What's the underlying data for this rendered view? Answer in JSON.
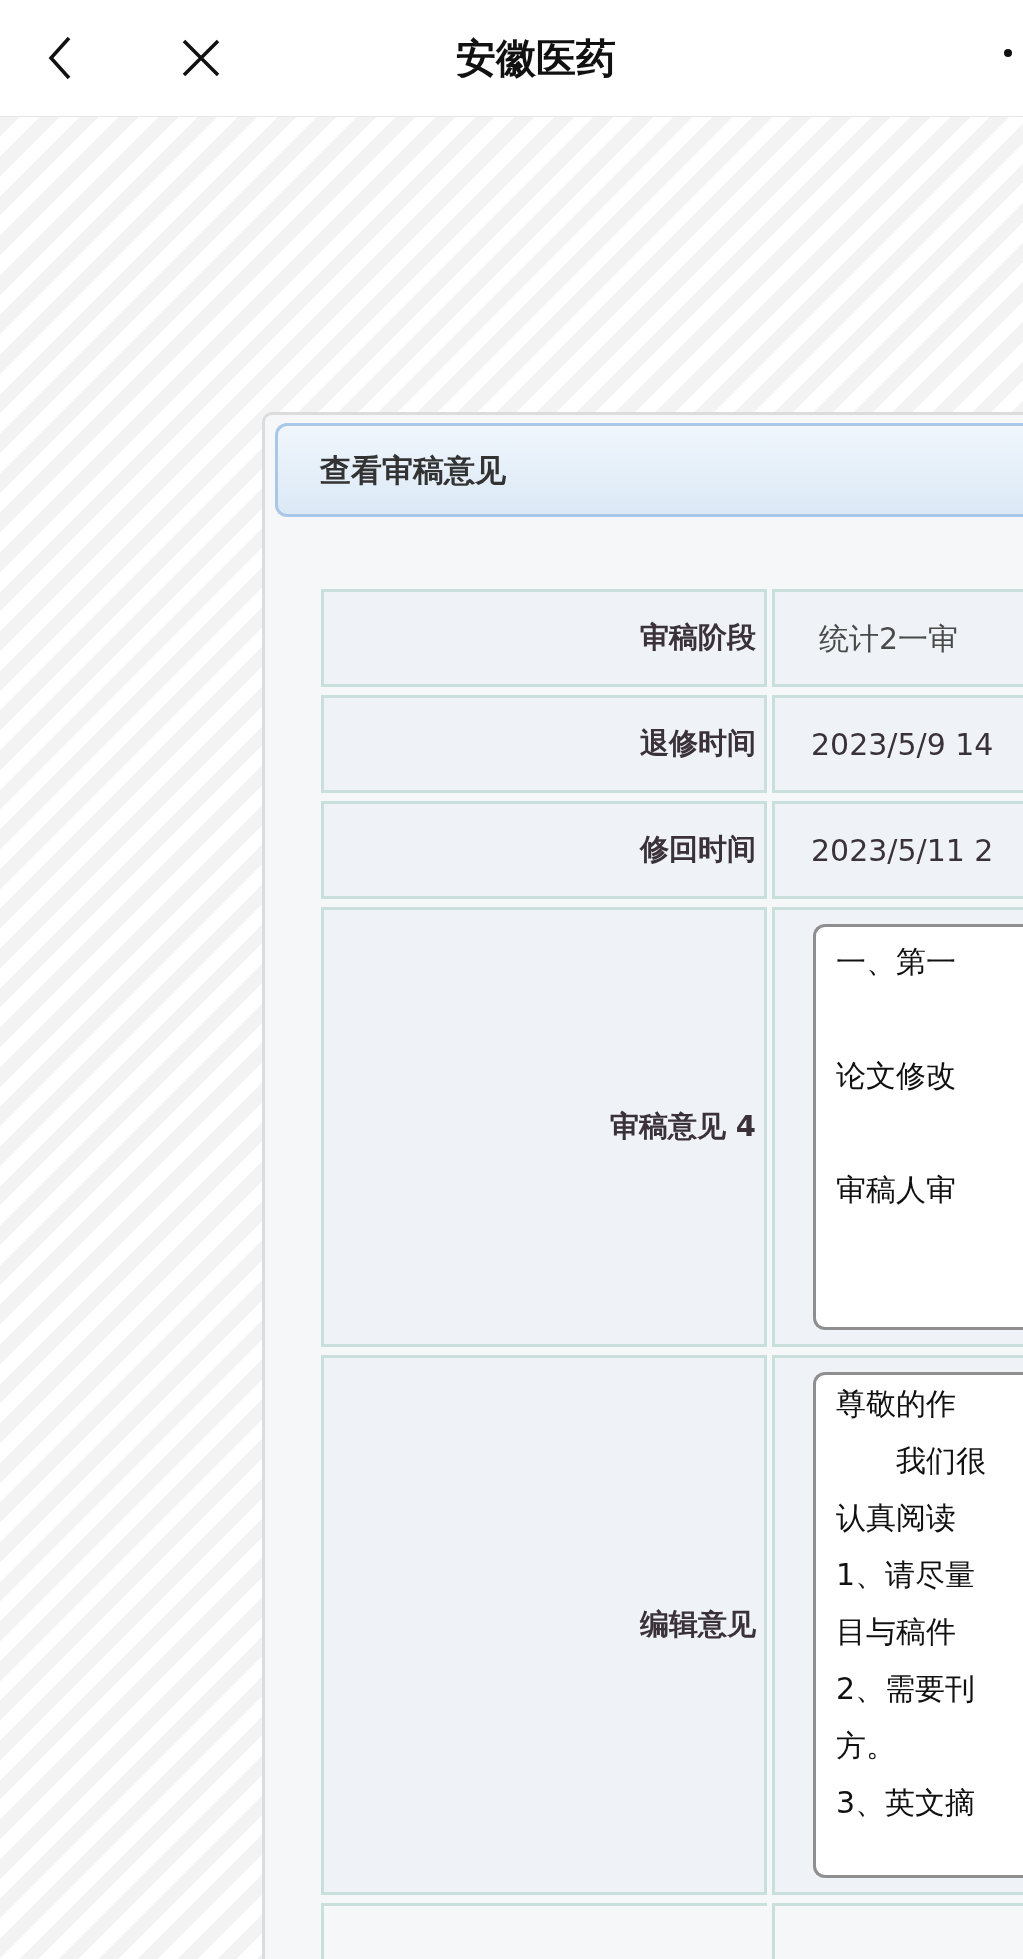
{
  "header": {
    "title": "安徽医药"
  },
  "dialog": {
    "title": "查看审稿意见",
    "rows": [
      {
        "kind": "text",
        "label": "审稿阶段",
        "value": "统计2一审"
      },
      {
        "kind": "text",
        "label": "退修时间",
        "value": "2023/5/9 14"
      },
      {
        "kind": "text",
        "label": "修回时间",
        "value": "2023/5/11 2"
      },
      {
        "kind": "spaced_box",
        "label": "审稿意见 4",
        "lines": [
          "一、第一",
          "论文修改",
          "审稿人审"
        ]
      },
      {
        "kind": "dense_box",
        "label": "编辑意见",
        "lines": [
          "尊敬的作",
          "　　我们很",
          "认真阅读",
          "1、请尽量",
          "目与稿件",
          "2、需要刊",
          "方。",
          "3、英文摘"
        ]
      }
    ]
  }
}
